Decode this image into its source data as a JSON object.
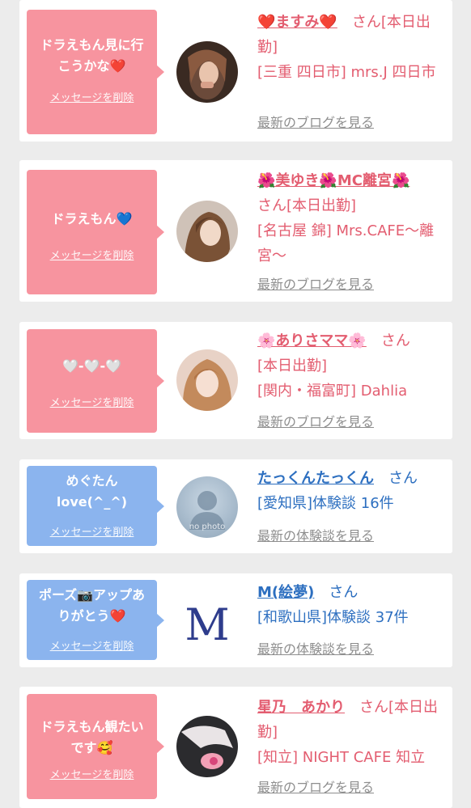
{
  "cards": [
    {
      "bubble_message": "ドラえもん見に行\nこうかな❤️",
      "bubble_delete": "メッセージを削除",
      "name": "❤️ますみ❤️",
      "info_rest": "　さん[本日出勤]",
      "detail": "[三重 四日市] mrs.J 四日市",
      "link": "最新のブログを見る"
    },
    {
      "bubble_message": "ドラえもん💙",
      "bubble_delete": "メッセージを削除",
      "name": "🌺美ゆき🌺MC離宮🌺",
      "info_rest": "さん[本日出勤]",
      "detail": "[名古屋 錦] Mrs.CAFE〜離宮〜",
      "link": "最新のブログを見る"
    },
    {
      "bubble_message": "🤍-🤍-🤍",
      "bubble_delete": "メッセージを削除",
      "name": "🌸ありさママ🌸",
      "info_rest": "　さん",
      "status": "[本日出勤]",
      "detail": "[関内・福富町] Dahlia",
      "link": "最新のブログを見る"
    },
    {
      "bubble_message": "めぐたん\nlove(^_^)",
      "bubble_delete": "メッセージを削除",
      "name": "たっくんたっくん",
      "info_rest": "　さん",
      "detail": "[愛知県]体験談 16件",
      "link": "最新の体験談を見る",
      "avatar_text": "no photo"
    },
    {
      "bubble_message": "ポーズ📷アップあ\nりがとう❤️",
      "bubble_delete": "メッセージを削除",
      "name": "M(絵夢)",
      "info_rest": "　さん",
      "detail": "[和歌山県]体験談 37件",
      "link": "最新の体験談を見る",
      "avatar_text": "M"
    },
    {
      "bubble_message": "ドラえもん観たい\nです🥰",
      "bubble_delete": "メッセージを削除",
      "name": "星乃　あかり",
      "info_rest": "　さん[本日出勤]",
      "detail": "[知立] NIGHT CAFE 知立",
      "link": "最新のブログを見る"
    }
  ],
  "colors": {
    "pink_bubble": "#f7949f",
    "blue_bubble": "#8bb4ee",
    "pink_text": "#e35d70",
    "blue_text": "#2d6fc0",
    "link_gray": "#8e8e8e",
    "background": "#ececec"
  }
}
